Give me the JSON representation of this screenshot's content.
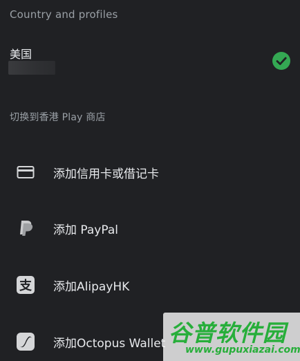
{
  "sections": {
    "country_title": "Country and profiles",
    "switch_title": "切换到香港 Play 商店"
  },
  "country": {
    "name": "美国",
    "selected": true,
    "accent_color": "#34a853"
  },
  "payment_options": [
    {
      "label": "添加信用卡或借记卡",
      "icon": "credit-card-icon"
    },
    {
      "label": "添加 PayPal",
      "icon": "paypal-icon"
    },
    {
      "label": "添加AlipayHK",
      "icon": "alipay-icon"
    },
    {
      "label": "添加Octopus Wallet",
      "icon": "octopus-icon"
    }
  ],
  "watermark": {
    "title": "谷普软件园",
    "url": "www.gupuxiazai.com",
    "color": "#27ae3a"
  }
}
